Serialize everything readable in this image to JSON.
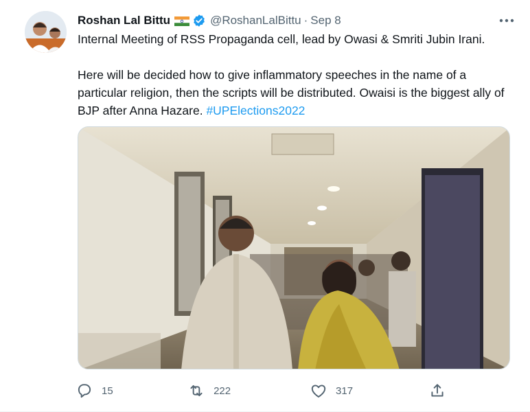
{
  "tweet": {
    "author_name": "Roshan Lal Bittu",
    "handle": "@RoshanLalBittu",
    "separator": "·",
    "date": "Sep 8",
    "flag_icon": "india-flag-icon",
    "verified_icon": "verified-badge-icon",
    "more_icon": "more-options-icon",
    "paragraph1": "Internal Meeting of RSS Propaganda cell, lead by Owasi & Smriti Jubin Irani.",
    "paragraph2": "Here will be decided how to give inflammatory speeches in the name of a particular religion, then the scripts will be distributed. Owaisi is the biggest ally of BJP after Anna Hazare. ",
    "hashtag": "#UPElections2022",
    "colors": {
      "accent": "#1d9bf0",
      "muted": "#536471",
      "text": "#0f1419"
    }
  },
  "actions": {
    "reply_count": "15",
    "retweet_count": "222",
    "like_count": "317"
  }
}
